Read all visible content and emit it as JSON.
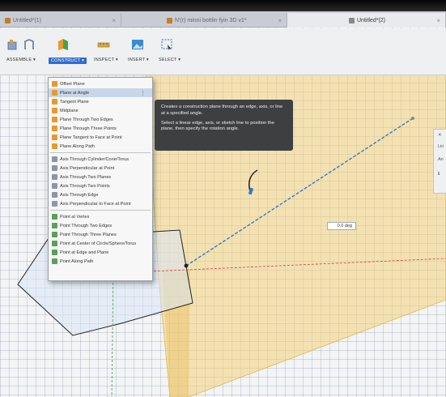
{
  "tabs": [
    {
      "label": "Untitled*(1)",
      "close": "×"
    },
    {
      "label": "N'(r) minni bottlin fyin 3D v1*",
      "close": "×"
    },
    {
      "label": "Untitled*(2)",
      "close": "×"
    }
  ],
  "toolbar": {
    "assemble": "ASSEMBLE ▾",
    "construct": "CONSTRUCT ▾",
    "inspect": "INSPECT ▾",
    "insert": "INSERT ▾",
    "select": "SELECT ▾"
  },
  "menu": {
    "items": [
      "Offset Plane",
      "Plane at Angle",
      "Tangent Plane",
      "Midplane",
      "Plane Through Two Edges",
      "Plane Through Three Points",
      "Plane Tangent to Face at Point",
      "Plane Along Path",
      "Axis Through Cylinder/Cone/Torus",
      "Axis Perpendicular at Point",
      "Axis Through Two Planes",
      "Axis Through Two Points",
      "Axis Through Edge",
      "Axis Perpendicular to Face at Point",
      "Point at Vertex",
      "Point Through Two Edges",
      "Point Through Three Planes",
      "Point at Center of Circle/Sphere/Torus",
      "Point at Edge and Plane",
      "Point Along Path"
    ],
    "kebab": "⋮"
  },
  "tooltip": {
    "line1": "Creates a construction plane through an edge, axis, or line at a specified angle.",
    "line2": "Select a linear edge, axis, or sketch line to position the plane, then specify the rotation angle."
  },
  "viewport": {
    "angle_value": "0.0 deg"
  },
  "right_panel": {
    "items": [
      "Lin",
      "An"
    ]
  },
  "colors": {
    "accent": "#2f6dd0",
    "plane_fill": "#f3d27a",
    "axis_red": "#d23b3b",
    "axis_green": "#3aa04a",
    "line_blue": "#3a78c8"
  }
}
